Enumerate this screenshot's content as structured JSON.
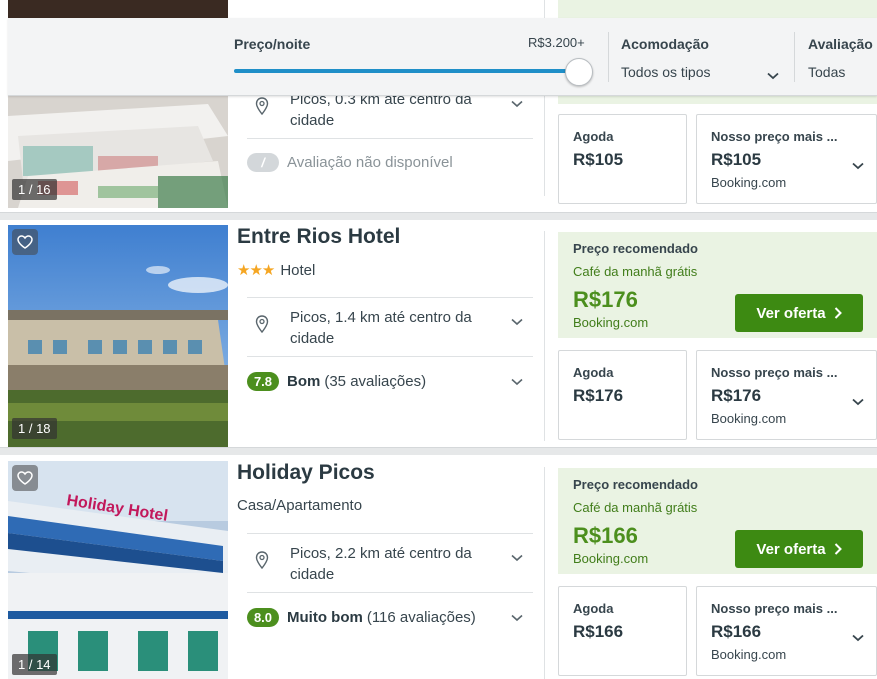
{
  "filters": {
    "price_label": "Preço/noite",
    "price_max": "R$3.200+",
    "price_level": 1.0,
    "accommodation_label": "Acomodação",
    "accommodation_value": "Todos os tipos",
    "rating_label": "Avaliação",
    "rating_value": "Todas"
  },
  "hotels": [
    {
      "location": "Picos, 0.3 km até centro da cidade",
      "rating_na": "Avaliação não disponível",
      "photo_count": "1 / 16",
      "agoda_label": "Agoda",
      "agoda_price": "R$105",
      "best_label": "Nosso preço mais ...",
      "best_price": "R$105",
      "best_provider": "Booking.com"
    },
    {
      "name": "Entre Rios Hotel",
      "stars": "★★★",
      "type": "Hotel",
      "location": "Picos, 1.4 km até centro da cidade",
      "score": "7.8",
      "score_label": "Bom",
      "reviews": "(35 avaliações)",
      "photo_count": "1 / 18",
      "rec_title": "Preço recomendado",
      "rec_sub": "Café da manhã grátis",
      "rec_price": "R$176",
      "rec_provider": "Booking.com",
      "offer_label": "Ver oferta",
      "agoda_label": "Agoda",
      "agoda_price": "R$176",
      "best_label": "Nosso preço mais ...",
      "best_price": "R$176",
      "best_provider": "Booking.com"
    },
    {
      "name": "Holiday Picos",
      "type": "Casa/Apartamento",
      "location": "Picos, 2.2 km até centro da cidade",
      "score": "8.0",
      "score_label": "Muito bom",
      "reviews": "(116 avaliações)",
      "photo_count": "1 / 14",
      "photo_sign": "Holiday Hotel",
      "rec_title": "Preço recomendado",
      "rec_sub": "Café da manhã grátis",
      "rec_price": "R$166",
      "rec_provider": "Booking.com",
      "offer_label": "Ver oferta",
      "agoda_label": "Agoda",
      "agoda_price": "R$166",
      "best_label": "Nosso preço mais ...",
      "best_price": "R$166",
      "best_provider": "Booking.com"
    }
  ],
  "colors": {
    "accent_green": "#3d8a12",
    "rec_bg": "#eaf3e3",
    "slider_blue": "#1f8fc8",
    "star": "#f5a623"
  }
}
